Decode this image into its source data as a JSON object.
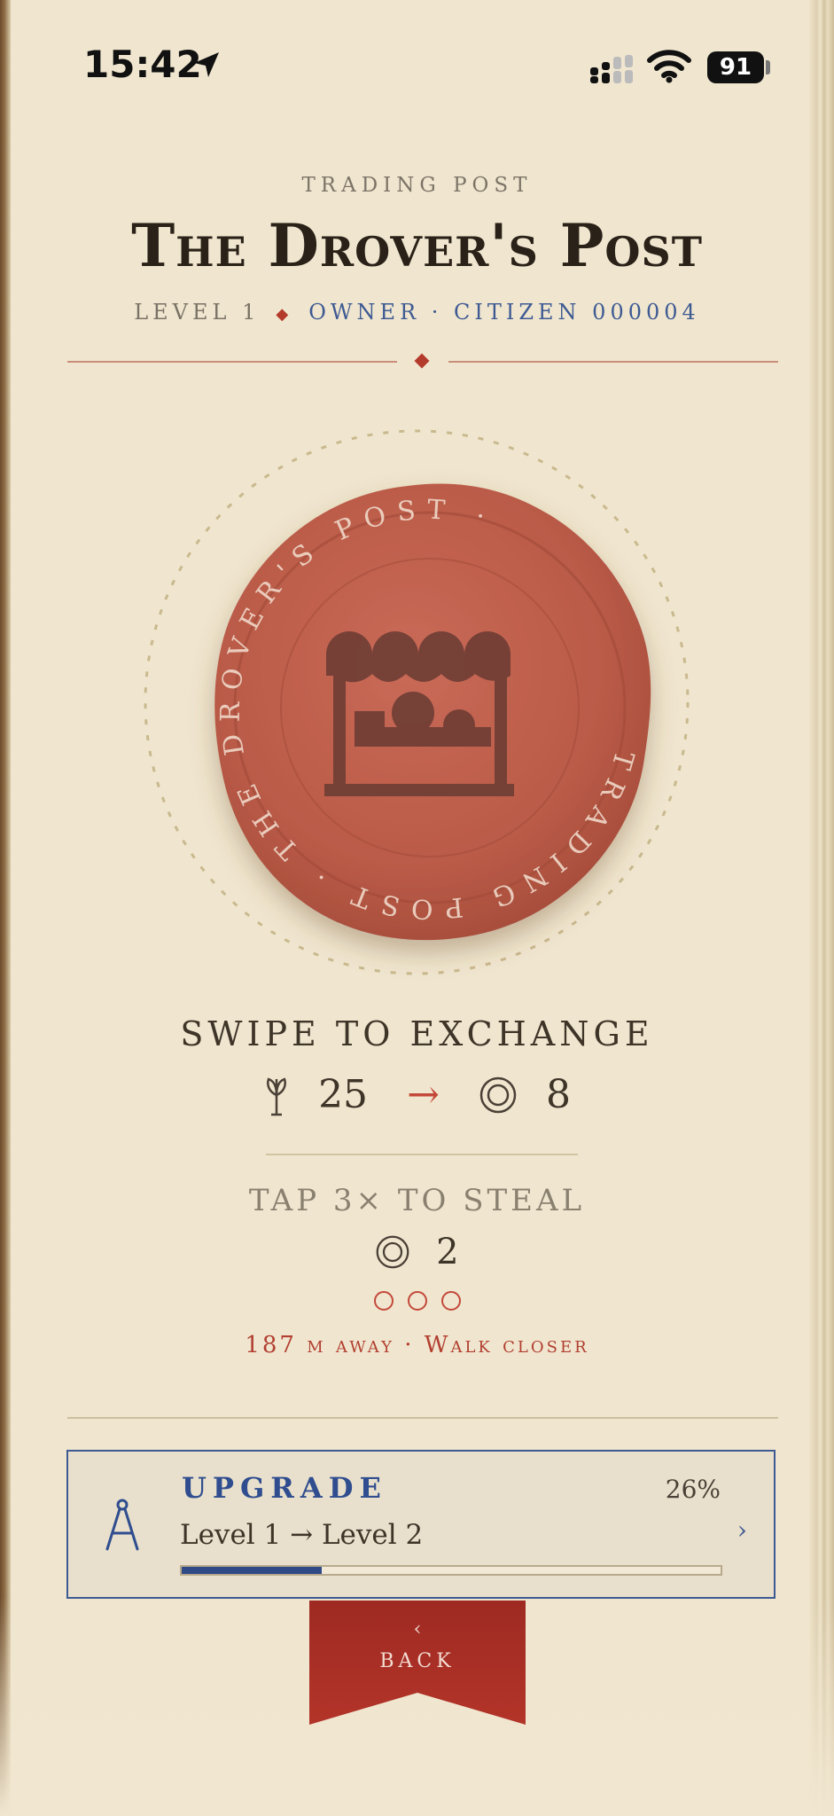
{
  "status_bar": {
    "time": "15:42",
    "battery": "91"
  },
  "header": {
    "kicker": "TRADING POST",
    "title": "The Drover's Post",
    "level": "LEVEL 1",
    "owner": "OWNER · CITIZEN 000004"
  },
  "seal": {
    "ring_text": "TRADING POST · THE DROVER'S POST ·",
    "icon": "market-stall-icon"
  },
  "exchange": {
    "label": "SWIPE TO EXCHANGE",
    "give_amount": "25",
    "give_icon": "grain-icon",
    "arrow": "→",
    "get_amount": "8",
    "get_icon": "coin-icon"
  },
  "steal": {
    "label": "TAP 3× TO STEAL",
    "amount": "2",
    "icon": "coin-icon",
    "taps_total": 3,
    "taps_done": 0,
    "distance_text": "187 m away · Walk closer"
  },
  "upgrade": {
    "label": "UPGRADE",
    "route": "Level 1 → Level 2",
    "percent_text": "26%",
    "progress": 0.26,
    "chevron": "›",
    "icon": "compass-icon"
  },
  "back": {
    "chevron": "‹",
    "label": "BACK"
  },
  "colors": {
    "background": "#f0e6cf",
    "accent_red": "#b43a2c",
    "accent_blue": "#3e5a93",
    "seal_wax": "#c0604e"
  }
}
